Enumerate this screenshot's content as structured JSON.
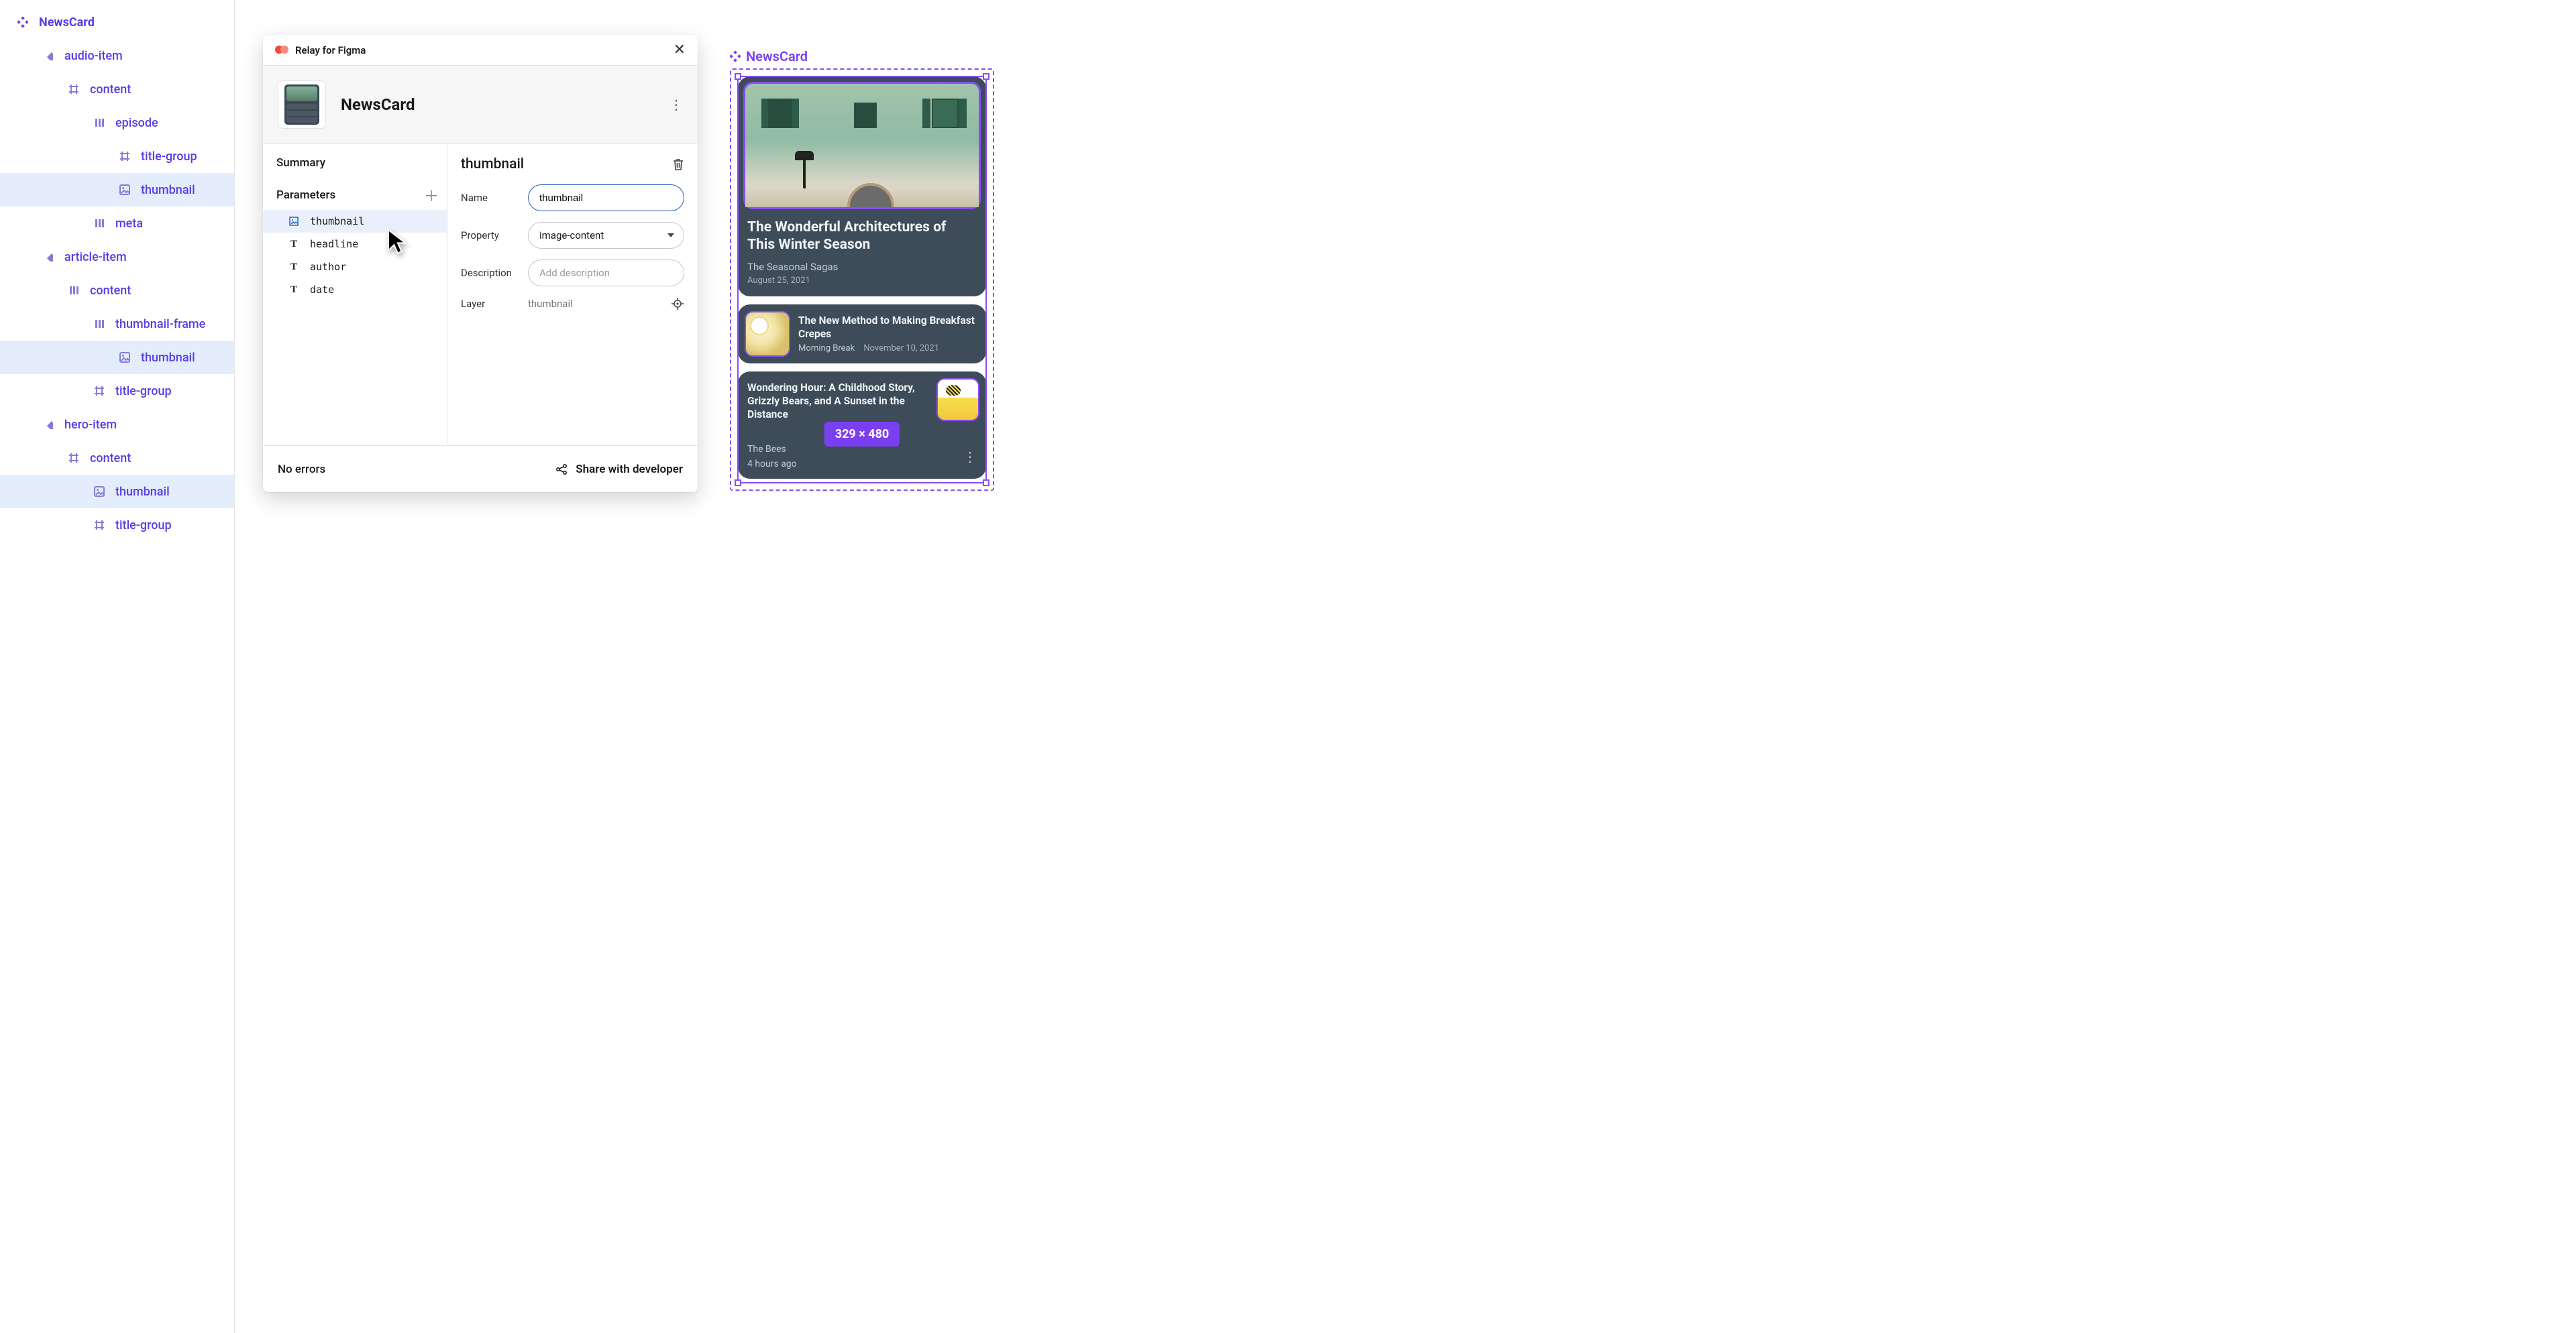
{
  "outline": {
    "root": {
      "label": "NewsCard",
      "icon": "component"
    },
    "items": [
      {
        "label": "audio-item",
        "icon": "instance",
        "indent": 1,
        "selected": false
      },
      {
        "label": "content",
        "icon": "frame",
        "indent": 2,
        "selected": false
      },
      {
        "label": "episode",
        "icon": "autolayout",
        "indent": 3,
        "selected": false
      },
      {
        "label": "title-group",
        "icon": "frame",
        "indent": 4,
        "selected": false
      },
      {
        "label": "thumbnail",
        "icon": "image",
        "indent": 4,
        "selected": true
      },
      {
        "label": "meta",
        "icon": "autolayout",
        "indent": 3,
        "selected": false
      },
      {
        "label": "article-item",
        "icon": "instance",
        "indent": 1,
        "selected": false
      },
      {
        "label": "content",
        "icon": "autolayout",
        "indent": 2,
        "selected": false
      },
      {
        "label": "thumbnail-frame",
        "icon": "autolayout",
        "indent": 3,
        "selected": false
      },
      {
        "label": "thumbnail",
        "icon": "image",
        "indent": 4,
        "selected": true
      },
      {
        "label": "title-group",
        "icon": "frame",
        "indent": 3,
        "selected": false
      },
      {
        "label": "hero-item",
        "icon": "instance",
        "indent": 1,
        "selected": false
      },
      {
        "label": "content",
        "icon": "frame",
        "indent": 2,
        "selected": false
      },
      {
        "label": "thumbnail",
        "icon": "image",
        "indent": 3,
        "selected": true
      },
      {
        "label": "title-group",
        "icon": "frame",
        "indent": 3,
        "selected": false
      }
    ]
  },
  "relay": {
    "plugin_name": "Relay for Figma",
    "component_name": "NewsCard",
    "summary_label": "Summary",
    "parameters_label": "Parameters",
    "parameters": [
      {
        "name": "thumbnail",
        "kind": "image",
        "selected": true
      },
      {
        "name": "headline",
        "kind": "text",
        "selected": false
      },
      {
        "name": "author",
        "kind": "text",
        "selected": false
      },
      {
        "name": "date",
        "kind": "text",
        "selected": false
      }
    ],
    "detail": {
      "title": "thumbnail",
      "fields": {
        "name_label": "Name",
        "name_value": "thumbnail",
        "property_label": "Property",
        "property_value": "image-content",
        "description_label": "Description",
        "description_placeholder": "Add description",
        "layer_label": "Layer",
        "layer_value": "thumbnail"
      }
    },
    "footer_status": "No errors",
    "footer_share": "Share with developer"
  },
  "canvas": {
    "label": "NewsCard",
    "size_badge": "329 × 480",
    "hero": {
      "title": "The Wonderful Architectures of This Winter Season",
      "source": "The Seasonal Sagas",
      "date": "August 25, 2021"
    },
    "article": {
      "title": "The New Method to Making Breakfast Crepes",
      "source": "Morning Break",
      "date": "November 10, 2021"
    },
    "audio": {
      "title": "Wondering Hour: A Childhood Story, Grizzly Bears, and A Sunset in the Distance",
      "source": "The Bees",
      "time": "4 hours ago"
    }
  }
}
